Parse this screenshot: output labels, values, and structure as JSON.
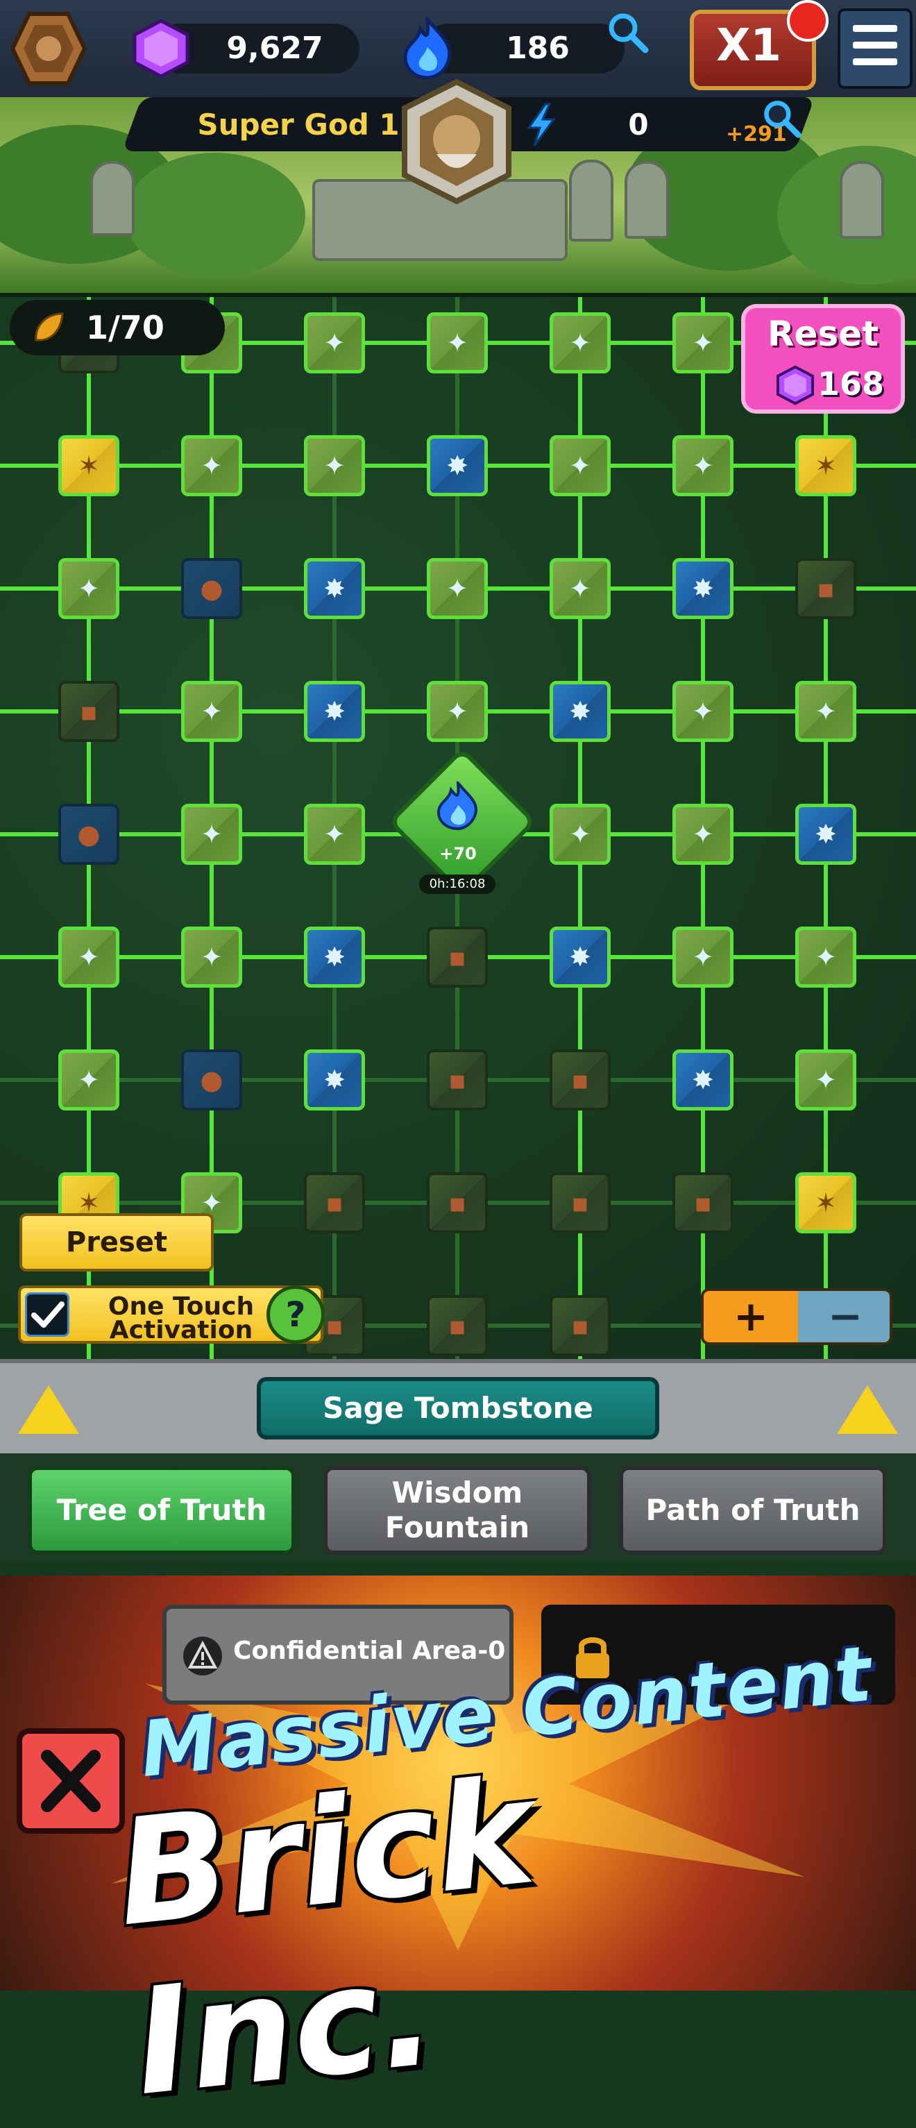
{
  "topbar": {
    "gems": "9,627",
    "flames": "186",
    "speed": "X1"
  },
  "level": {
    "title": "Super God 1",
    "energy": "0",
    "energy_bonus": "+291"
  },
  "tree": {
    "seeds": "1/70",
    "reset_label": "Reset",
    "reset_cost": "168",
    "center_bonus": "+70",
    "center_timer": "0h:16:08"
  },
  "controls": {
    "preset": "Preset",
    "one_touch_line1": "One Touch",
    "one_touch_line2": "Activation",
    "help": "?",
    "zoom_in": "+",
    "zoom_out": "−"
  },
  "tombstone": {
    "title": "Sage Tombstone"
  },
  "tabs": [
    {
      "label": "Tree of Truth",
      "active": true
    },
    {
      "label": "Wisdom\nFountain",
      "active": false
    },
    {
      "label": "Path of Truth",
      "active": false
    }
  ],
  "ad": {
    "area_label": "Confidential Area-0",
    "line1": "Massive Content",
    "line2": "Brick Inc."
  }
}
